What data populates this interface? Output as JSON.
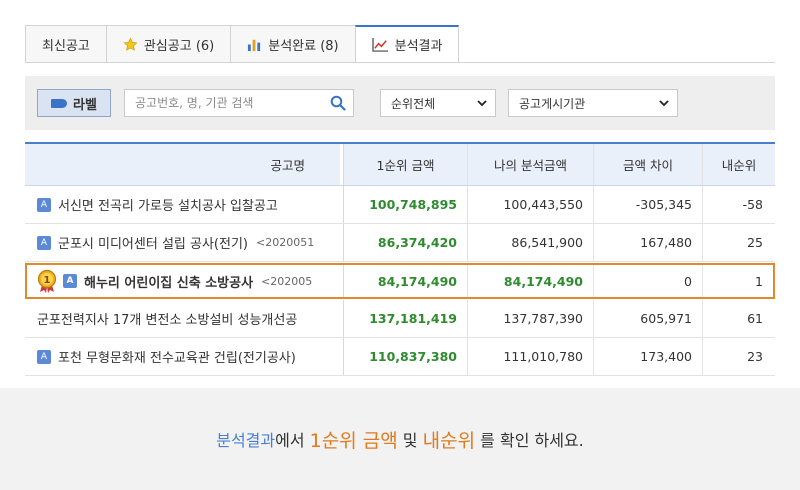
{
  "tabs": [
    {
      "label": "최신공고",
      "icon": "none"
    },
    {
      "label": "관심공고 (6)",
      "icon": "star-icon"
    },
    {
      "label": "분석완료 (8)",
      "icon": "bar-chart-icon"
    },
    {
      "label": "분석결과",
      "icon": "line-chart-icon"
    }
  ],
  "filter": {
    "label_button": "라벨",
    "search_placeholder": "공고번호, 명, 기관 검색",
    "select_rank": "순위전체",
    "select_org": "공고게시기관"
  },
  "table": {
    "headers": {
      "name": "공고명",
      "rank1_amount": "1순위 금액",
      "my_amount": "나의 분석금액",
      "diff": "금액 차이",
      "my_rank": "내순위"
    },
    "rows": [
      {
        "badge": "A",
        "name": "서신면 전곡리 가로등 설치공사 입찰공고",
        "date": "",
        "rank1_amount": "100,748,895",
        "my_amount": "100,443,550",
        "diff": "-305,345",
        "my_rank": "-58"
      },
      {
        "badge": "A",
        "name": "군포시 미디어센터 설립 공사(전기)",
        "date": "<2020051",
        "rank1_amount": "86,374,420",
        "my_amount": "86,541,900",
        "diff": "167,480",
        "my_rank": "25"
      },
      {
        "badge": "A",
        "name": "해누리 어린이집 신축 소방공사",
        "date": "<202005",
        "rank1_amount": "84,174,490",
        "my_amount": "84,174,490",
        "diff": "0",
        "my_rank": "1",
        "medal": "1"
      },
      {
        "badge": "",
        "name": "군포전력지사 17개 변전소 소방설비 성능개선공",
        "date": "",
        "rank1_amount": "137,181,419",
        "my_amount": "137,787,390",
        "diff": "605,971",
        "my_rank": "61"
      },
      {
        "badge": "A",
        "name": "포천 무형문화재 전수교육관 건립(전기공사)",
        "date": "",
        "rank1_amount": "110,837,380",
        "my_amount": "111,010,780",
        "diff": "173,400",
        "my_rank": "23"
      }
    ]
  },
  "banner": {
    "part1": "분석결과",
    "part2": "에서 ",
    "part3": "1순위 금액",
    "part4": " 및 ",
    "part5": "내순위",
    "part6": " 를 확인 하세요."
  },
  "colors": {
    "accent": "#4a7fd0",
    "green": "#2e8b2e",
    "highlight": "#e08a2e"
  }
}
